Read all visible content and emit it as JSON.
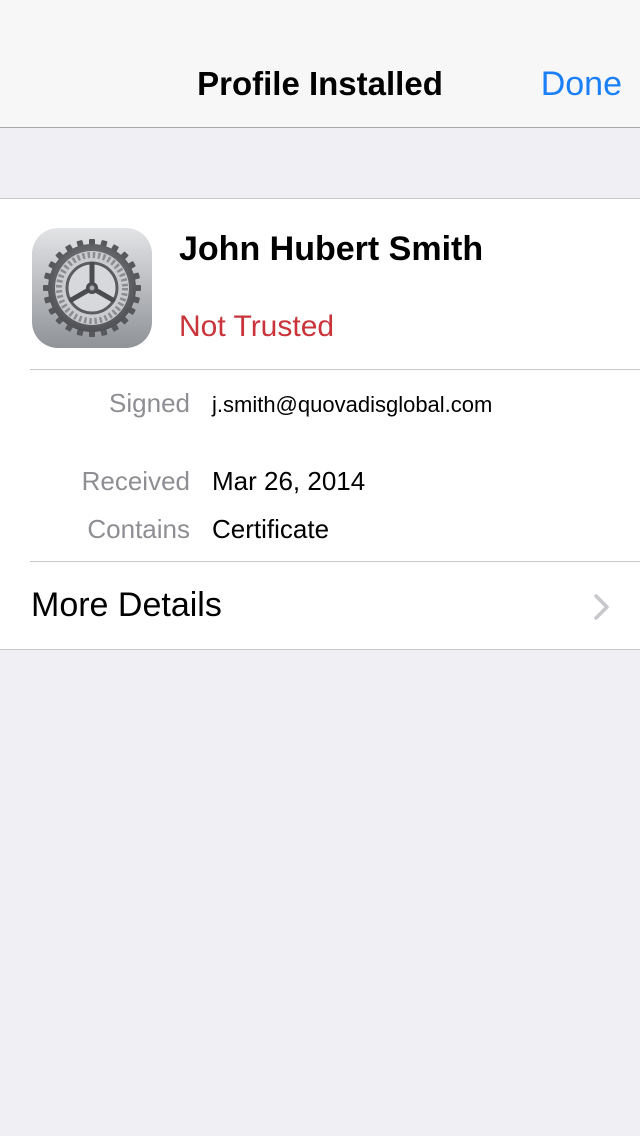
{
  "nav": {
    "title": "Profile Installed",
    "done_label": "Done"
  },
  "profile": {
    "name": "John Hubert Smith",
    "status": "Not Trusted",
    "icon": "settings-gear-icon"
  },
  "details": [
    {
      "label": "Signed",
      "value": "j.smith@quovadisglobal.com"
    },
    {
      "label": "Received",
      "value": "Mar 26, 2014"
    },
    {
      "label": "Contains",
      "value": "Certificate"
    }
  ],
  "more_details": {
    "label": "More Details",
    "icon": "chevron-right-icon"
  },
  "colors": {
    "accent": "#1b7ff5",
    "status_untrusted": "#c9343b",
    "background": "#efeff4",
    "label_gray": "#8e8e93"
  }
}
